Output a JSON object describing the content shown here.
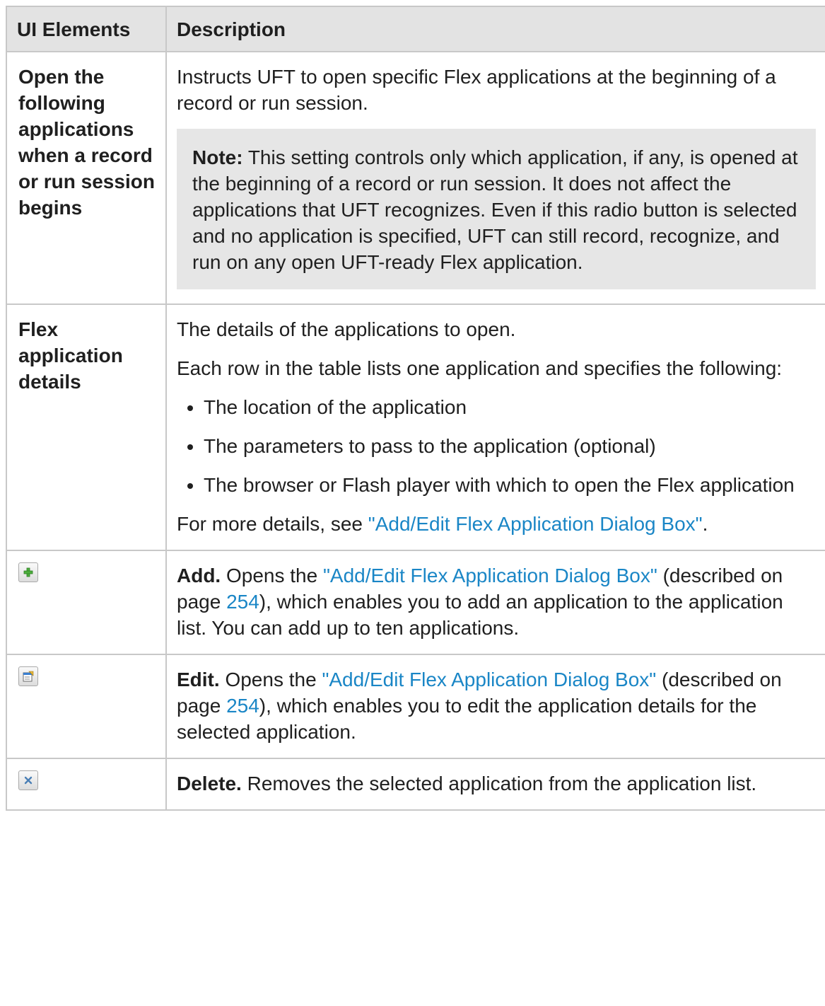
{
  "table": {
    "header": {
      "col1": "UI Elements",
      "col2": "Description"
    },
    "rows": {
      "open_apps": {
        "name": "Open the following applications when a record or run session begins",
        "description": "Instructs UFT to open specific Flex applications at the beginning of a record or run session.",
        "note_label": "Note:",
        "note_text": " This setting controls only which application, if any, is opened at the beginning of a record or run session. It does not affect the applications that UFT recognizes. Even if this radio button is selected and no application is specified, UFT can still record, recognize, and run on any open UFT-ready Flex application."
      },
      "flex_details": {
        "name": "Flex application details",
        "intro": "The details of the applications to open.",
        "each_row": "Each row in the table lists one application and specifies the following:",
        "bullets": [
          "The location of the application",
          "The parameters to pass to the application (optional)",
          "The browser or Flash player with which to open the Flex application"
        ],
        "more_prefix": "For more details, see ",
        "more_link": "\"Add/Edit Flex Application Dialog Box\"",
        "more_suffix": "."
      },
      "add": {
        "icon": "add-icon",
        "label": "Add.",
        "text1": " Opens the ",
        "link": "\"Add/Edit Flex Application Dialog Box\"",
        "text2": " (described on page ",
        "page": "254",
        "text3": "), which enables you to add an application to the application list. You can add up to ten applications."
      },
      "edit": {
        "icon": "edit-icon",
        "label": "Edit.",
        "text1": " Opens the ",
        "link": "\"Add/Edit Flex Application Dialog Box\"",
        "text2": " (described on page ",
        "page": "254",
        "text3": "), which enables you to edit the application details for the selected application."
      },
      "delete": {
        "icon": "delete-icon",
        "label": "Delete.",
        "text1": " Removes the selected application from the application list."
      }
    }
  },
  "colors": {
    "link": "#1a86c6",
    "header_bg": "#e3e3e3",
    "note_bg": "#e6e6e6",
    "border": "#c8c8c8"
  }
}
